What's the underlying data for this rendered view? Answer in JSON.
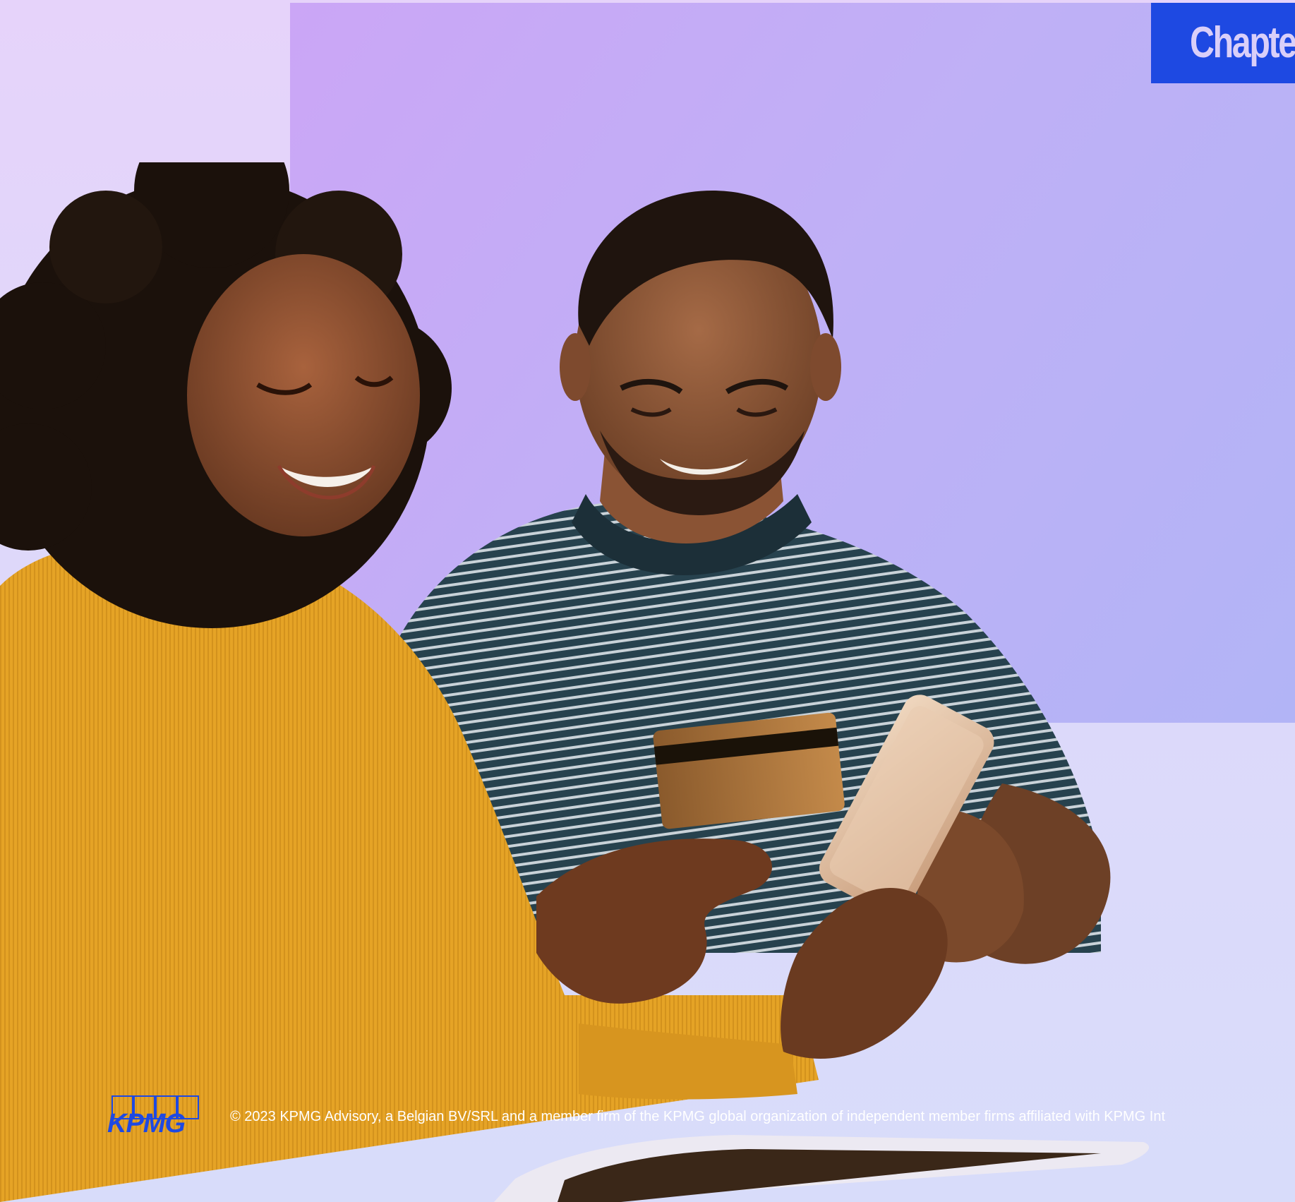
{
  "colors": {
    "page_background": "#e3d6fa",
    "hero_panel": "#c4abf6",
    "chapter_tab": "#1e49e2",
    "chapter_tab_text": "#d9cff9",
    "kpmg_blue": "#1e49e2",
    "footer_text": "#ffffff"
  },
  "header": {
    "chapter_label": "Chapte"
  },
  "photo": {
    "icon": "people-with-card-and-phone-photo"
  },
  "footer": {
    "logo_text": "KPMG",
    "copyright": "© 2023 KPMG Advisory, a Belgian BV/SRL and a member firm of the KPMG global organization of independent member firms affiliated with KPMG Int"
  }
}
